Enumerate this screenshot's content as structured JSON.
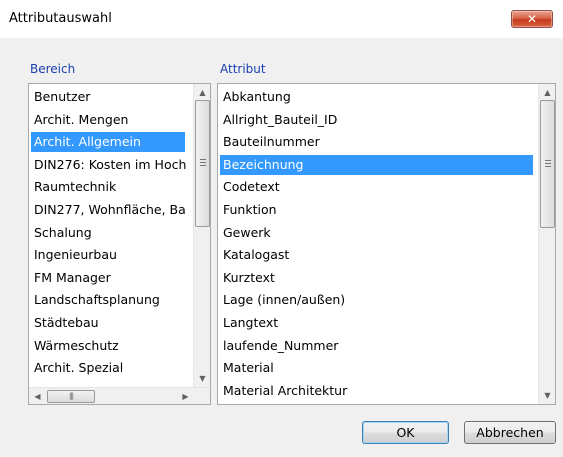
{
  "window": {
    "title": "Attributauswahl",
    "close_icon": "close-x-icon",
    "close_glyph": "✕"
  },
  "bereich": {
    "label": "Bereich",
    "items": [
      "Benutzer",
      "Archit. Mengen",
      "Archit. Allgemein",
      "DIN276: Kosten im Hoch",
      "Raumtechnik",
      "DIN277, Wohnfläche, Ba",
      "Schalung",
      "Ingenieurbau",
      "FM Manager",
      "Landschaftsplanung",
      "Städtebau",
      "Wärmeschutz",
      "Archit. Spezial"
    ],
    "selected": "Archit. Allgemein"
  },
  "attribut": {
    "label": "Attribut",
    "items": [
      "Abkantung",
      "Allright_Bauteil_ID",
      "Bauteilnummer",
      "Bezeichnung",
      "Codetext",
      "Funktion",
      "Gewerk",
      "Katalogast",
      "Kurztext",
      "Lage (innen/außen)",
      "Langtext",
      "laufende_Nummer",
      "Material",
      "Material Architektur"
    ],
    "selected": "Bezeichnung"
  },
  "buttons": {
    "ok": "OK",
    "cancel": "Abbrechen"
  }
}
